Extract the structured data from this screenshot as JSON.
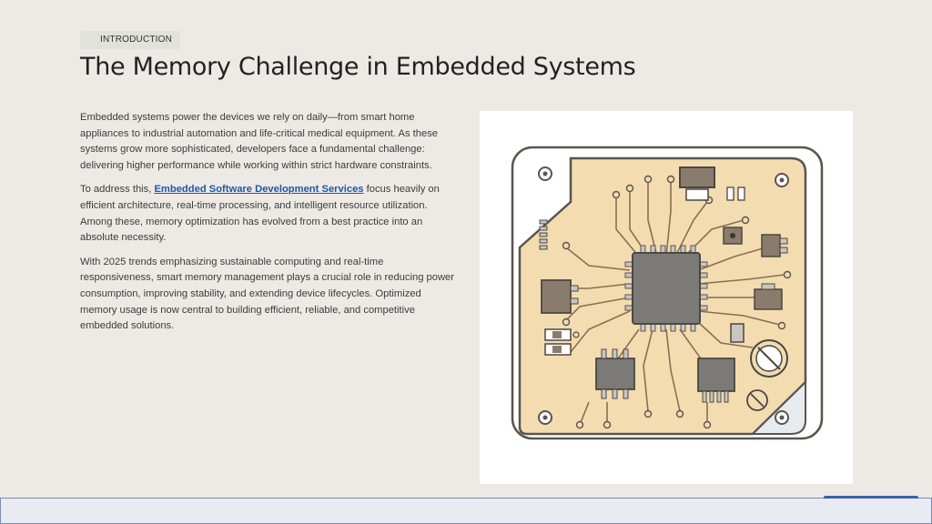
{
  "slide": {
    "section_label": "INTRODUCTION",
    "title": "The Memory Challenge in Embedded Systems",
    "paragraph1": "Embedded systems power the devices we rely on daily—from smart home appliances to industrial automation and life-critical medical equipment. As these systems grow more sophisticated, developers face a fundamental challenge: delivering higher performance while working within strict hardware constraints.",
    "paragraph2_before_link": "To address this, ",
    "paragraph2_link": "Embedded Software Development Services",
    "paragraph2_after_link": " focus heavily on efficient architecture, real-time processing, and intelligent resource utilization. Among these, memory optimization has evolved from a best practice into an absolute necessity.",
    "paragraph3": "With 2025 trends emphasizing sustainable computing and real-time responsiveness, smart memory management plays a crucial role in reducing power consumption, improving stability, and extending device lifecycles. Optimized memory usage is now central to building efficient, reliable, and competitive embedded solutions."
  },
  "colors": {
    "background": "#edeae5",
    "link": "#1f57a8",
    "board": "#f3dcb0",
    "chip": "#7c7a76"
  },
  "image": {
    "subject": "circuit-board-icon"
  }
}
